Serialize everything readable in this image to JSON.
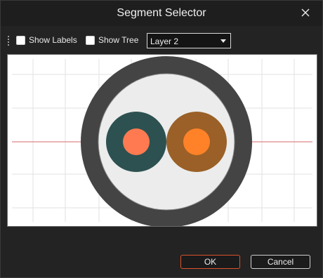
{
  "window": {
    "title": "Segment Selector"
  },
  "toolbar": {
    "show_labels": {
      "label": "Show Labels",
      "checked": false
    },
    "show_tree": {
      "label": "Show Tree",
      "checked": false
    },
    "layer_select": {
      "value": "Layer 2"
    }
  },
  "buttons": {
    "ok": "OK",
    "cancel": "Cancel"
  },
  "icons": {
    "close": "close-icon",
    "grip": "toolbar-grip-icon",
    "dropdown": "chevron-down-icon"
  },
  "colors": {
    "outer_ring": "#444444",
    "inner_disc": "#ececec",
    "left_conductor": "#2d5151",
    "left_core": "#ff7a50",
    "right_conductor": "#9a6027",
    "right_core": "#ff8228",
    "axis_line": "#d46a6a",
    "grid": "#e2e2e2",
    "ok_border": "#d9532c"
  }
}
